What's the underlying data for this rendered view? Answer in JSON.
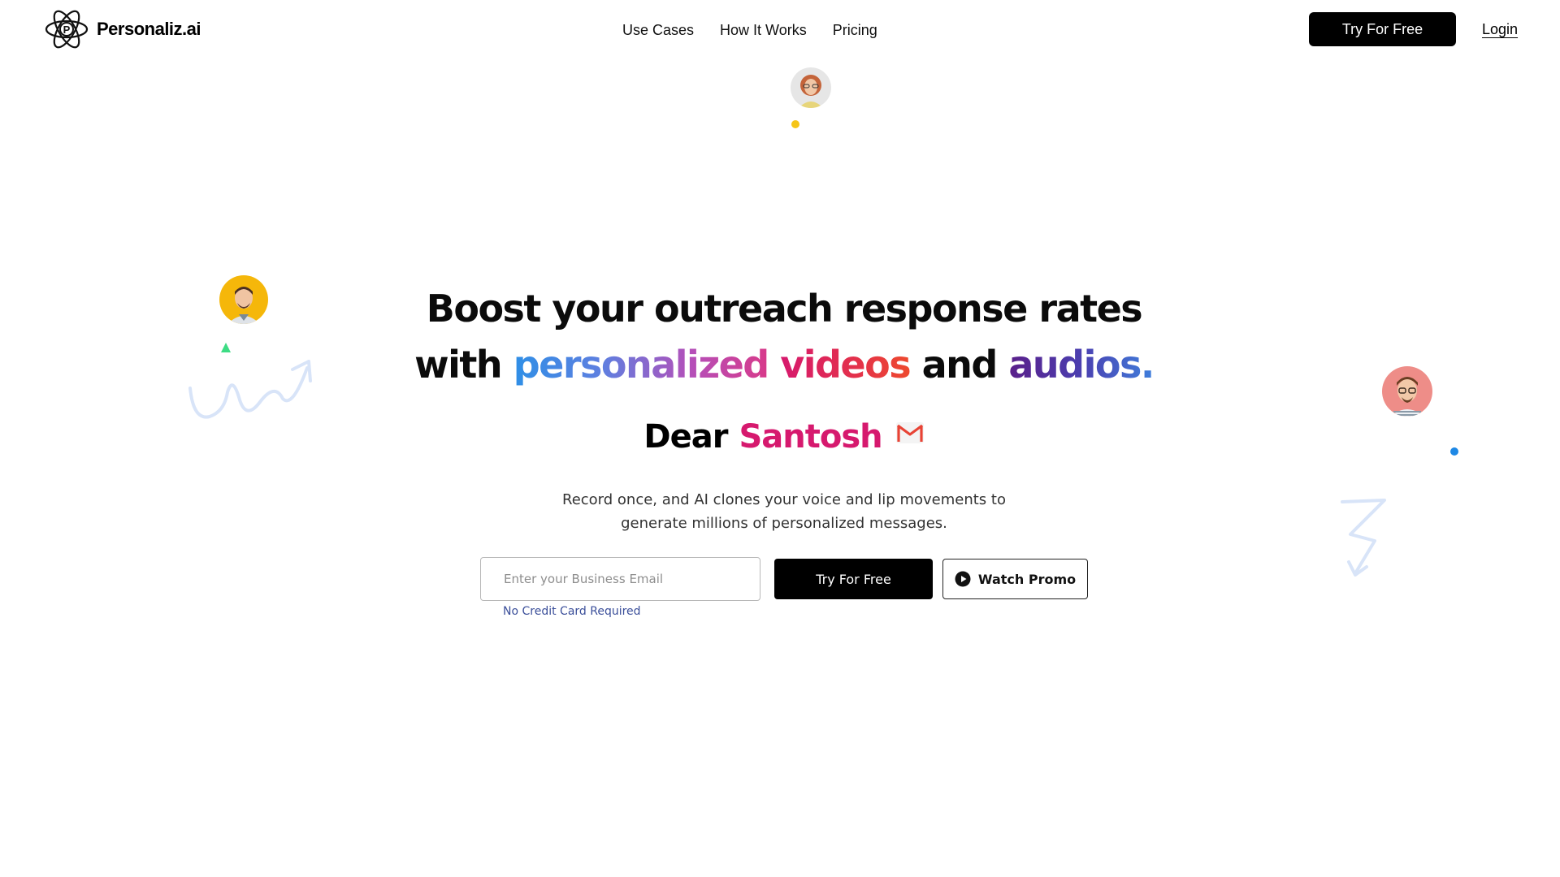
{
  "brand": {
    "name": "Personaliz.ai",
    "logo_letter": "P"
  },
  "nav": {
    "items": [
      {
        "label": "Use Cases"
      },
      {
        "label": "How It Works"
      },
      {
        "label": "Pricing"
      }
    ],
    "cta_label": "Try For Free",
    "login_label": "Login"
  },
  "hero": {
    "title_line1": "Boost your outreach response rates",
    "title_line2_part1": "with",
    "title_line2_part2": "personalized",
    "title_line2_part3": "videos",
    "title_line2_part4": "and",
    "title_line2_part5": "audios.",
    "greeting": "Dear",
    "recipient_name": "Santosh",
    "subtitle_line1": "Record once, and AI clones your voice and lip movements to",
    "subtitle_line2": "generate millions of personalized messages.",
    "email_placeholder": "Enter your Business Email",
    "no_credit_card": "No Credit Card Required",
    "try_label": "Try For Free",
    "promo_label": "Watch Promo"
  },
  "colors": {
    "accent_pink": "#d6196e",
    "accent_blue": "#2f8fe6",
    "accent_purple": "#5a1f8a",
    "dot_yellow": "#f5c518",
    "dot_blue": "#1e88e5",
    "triangle_green": "#3ddc84"
  },
  "icons": [
    "atom-logo-icon",
    "gmail-icon",
    "play-icon",
    "squiggle-arrow-icon",
    "zigzag-arrow-icon"
  ]
}
